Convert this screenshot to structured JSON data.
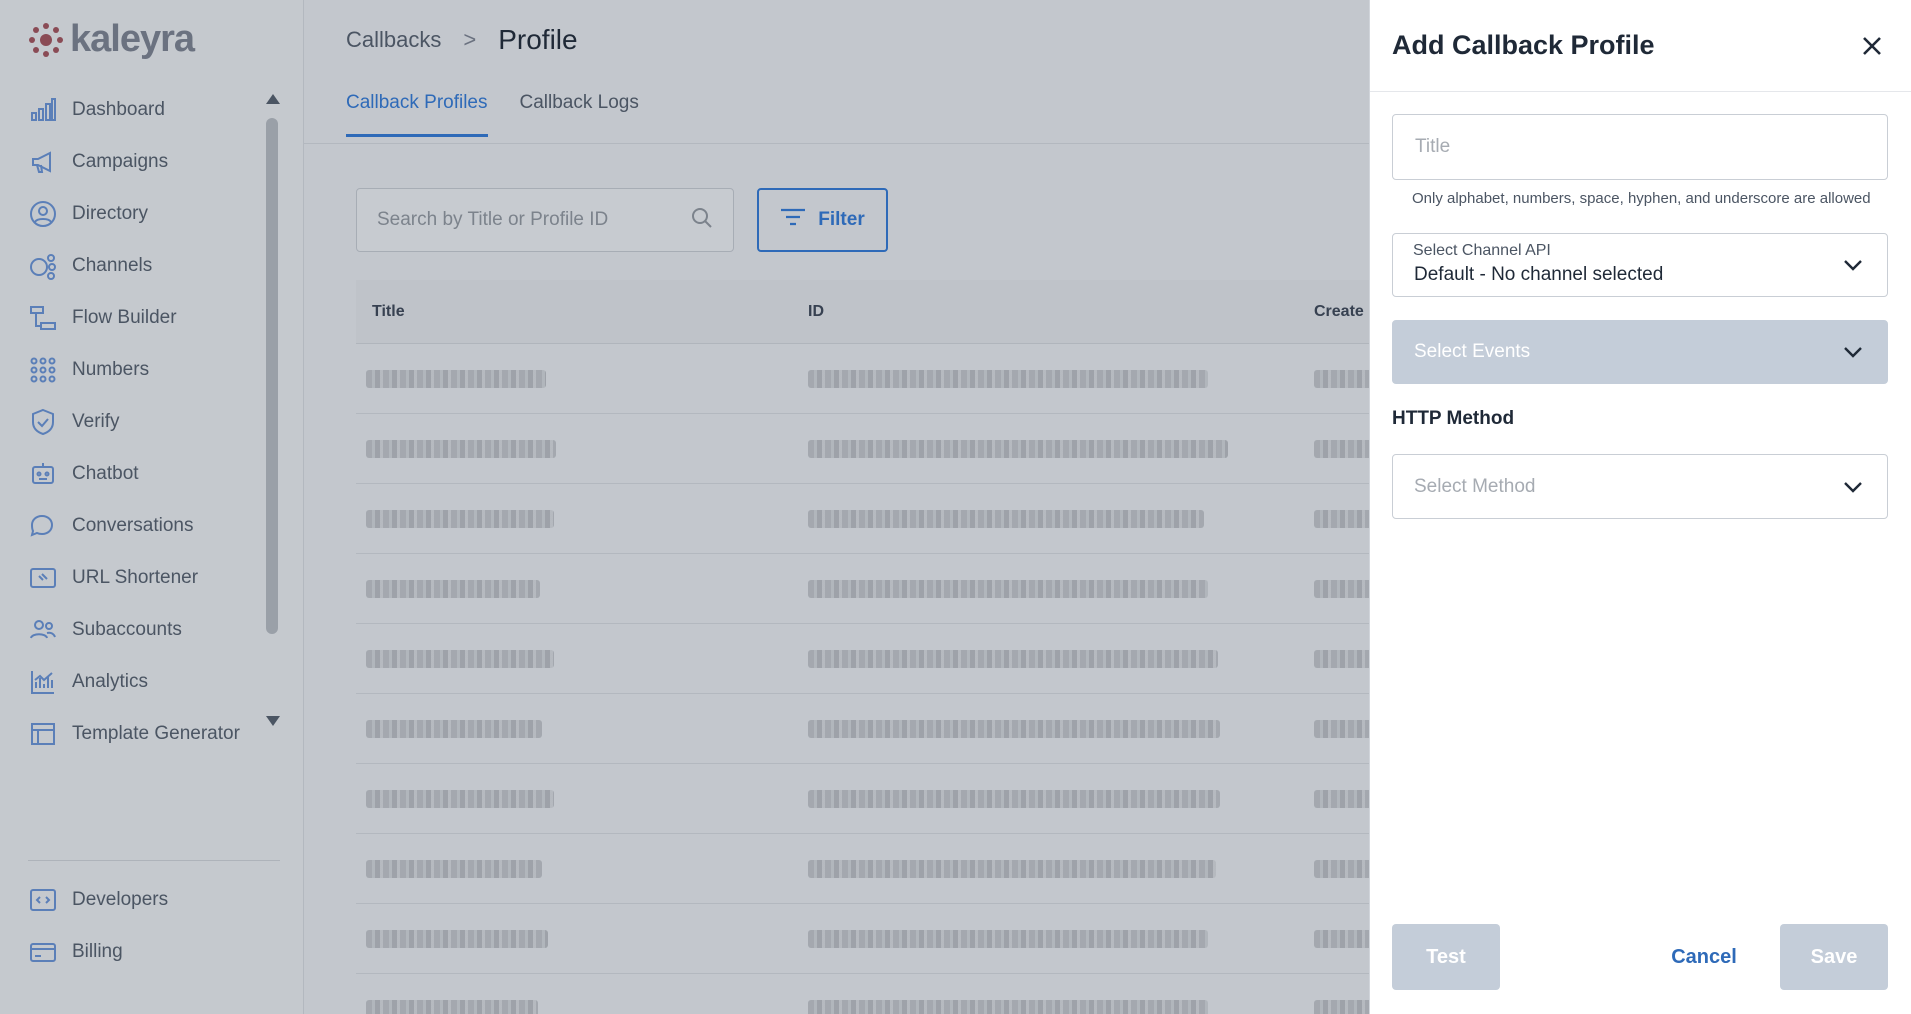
{
  "brand": {
    "name": "kaleyra"
  },
  "sidebar": {
    "items": [
      {
        "label": "Dashboard",
        "icon": "bar-chart-icon"
      },
      {
        "label": "Campaigns",
        "icon": "megaphone-icon"
      },
      {
        "label": "Directory",
        "icon": "user-circle-icon"
      },
      {
        "label": "Channels",
        "icon": "channels-icon"
      },
      {
        "label": "Flow Builder",
        "icon": "flow-builder-icon"
      },
      {
        "label": "Numbers",
        "icon": "dial-pad-icon"
      },
      {
        "label": "Verify",
        "icon": "shield-check-icon"
      },
      {
        "label": "Chatbot",
        "icon": "robot-icon"
      },
      {
        "label": "Conversations",
        "icon": "chat-bubbles-icon"
      },
      {
        "label": "URL Shortener",
        "icon": "link-icon"
      },
      {
        "label": "Subaccounts",
        "icon": "users-icon"
      },
      {
        "label": "Analytics",
        "icon": "analytics-icon"
      },
      {
        "label": "Template Generator",
        "icon": "template-icon"
      }
    ],
    "bottom_items": [
      {
        "label": "Developers",
        "icon": "code-icon"
      },
      {
        "label": "Billing",
        "icon": "credit-card-icon"
      }
    ]
  },
  "breadcrumb": {
    "parent": "Callbacks",
    "separator": ">",
    "current": "Profile"
  },
  "tabs": [
    {
      "label": "Callback Profiles",
      "active": true
    },
    {
      "label": "Callback Logs",
      "active": false
    }
  ],
  "search": {
    "placeholder": "Search by Title or Profile ID"
  },
  "filter": {
    "label": "Filter"
  },
  "table": {
    "columns": [
      "Title",
      "ID",
      "Create"
    ],
    "row_count_visible": 10,
    "note": "row contents are blurred"
  },
  "panel": {
    "title": "Add Callback Profile",
    "title_field": {
      "placeholder": "Title",
      "value": ""
    },
    "title_hint": "Only alphabet, numbers, space, hyphen, and underscore are allowed",
    "channel_api": {
      "label": "Select Channel API",
      "value": "Default - No channel selected"
    },
    "events": {
      "placeholder": "Select Events"
    },
    "http_method": {
      "section_title": "HTTP Method",
      "placeholder": "Select Method"
    },
    "buttons": {
      "test": "Test",
      "cancel": "Cancel",
      "save": "Save"
    }
  },
  "colors": {
    "accent": "#2e6ab8",
    "disabled": "#c4cdd9",
    "overlay": "#c3c7cd"
  }
}
